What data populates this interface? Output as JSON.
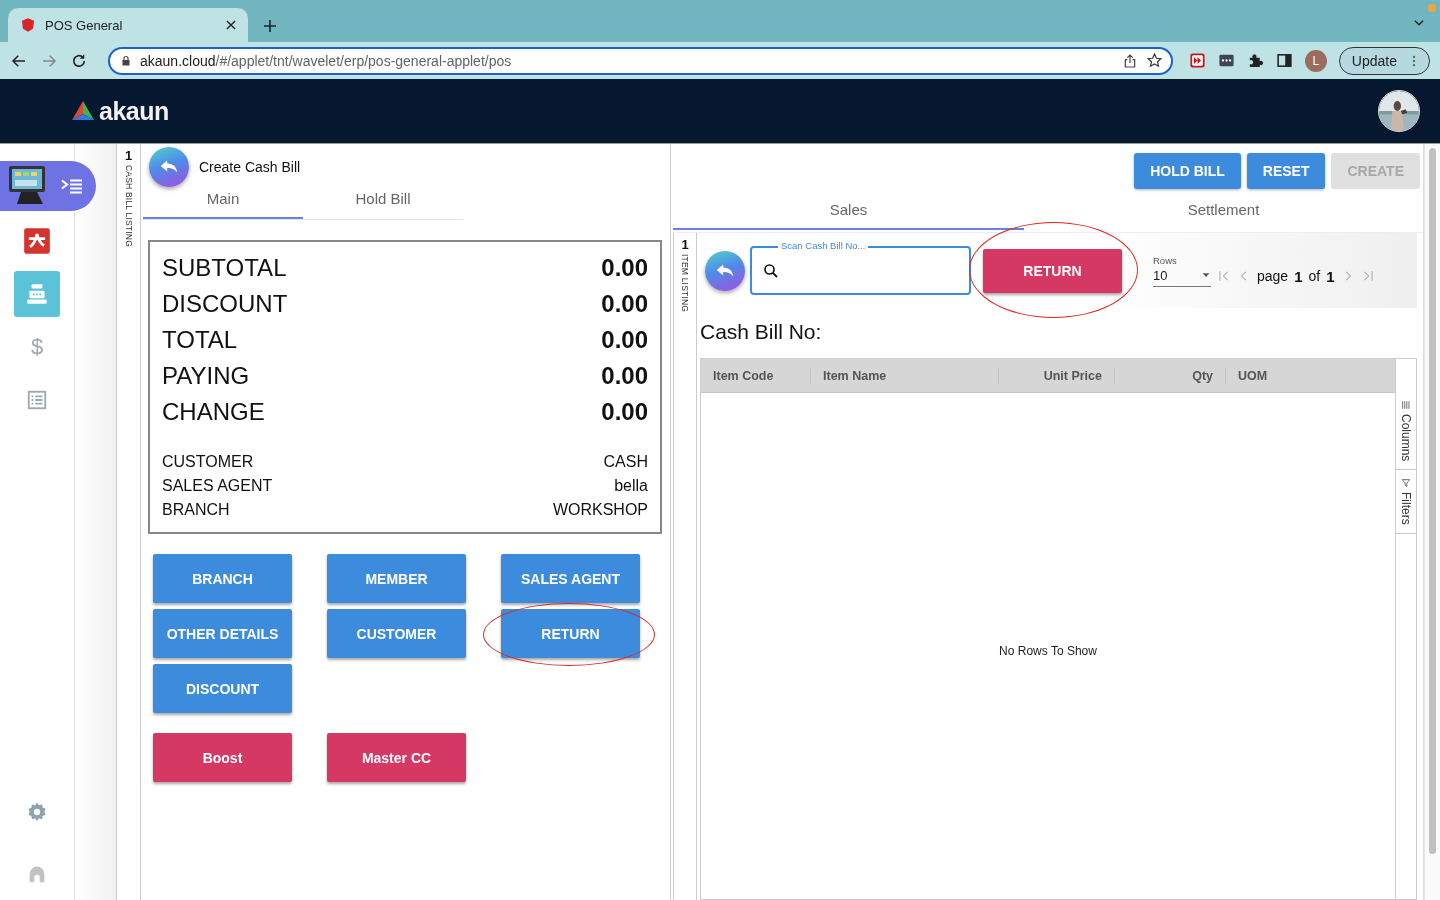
{
  "browser": {
    "tab_title": "POS General",
    "url_host": "akaun.cloud",
    "url_path": "/#/applet/tnt/wavelet/erp/pos-general-applet/pos",
    "profile_initial": "L",
    "update_label": "Update"
  },
  "app": {
    "logo": "akaun"
  },
  "sidebar": {
    "items": [
      {
        "kind": "pos",
        "selected": false
      },
      {
        "kind": "app",
        "selected": false
      },
      {
        "kind": "register",
        "selected": true
      },
      {
        "kind": "glyph",
        "glyph": "$",
        "selected": false
      },
      {
        "kind": "list",
        "selected": false
      }
    ],
    "bottom": [
      {
        "kind": "settings"
      },
      {
        "kind": "user"
      }
    ]
  },
  "bill_panel": {
    "strip_count": "1",
    "strip_label": "CASH BILL LISTING",
    "title": "Create Cash Bill",
    "tabs": [
      {
        "label": "Main",
        "selected": true
      },
      {
        "label": "Hold Bill",
        "selected": false
      }
    ],
    "totals": [
      {
        "label": "SUBTOTAL",
        "value": "0.00"
      },
      {
        "label": "DISCOUNT",
        "value": "0.00"
      },
      {
        "label": "TOTAL",
        "value": "0.00"
      },
      {
        "label": "PAYING",
        "value": "0.00"
      },
      {
        "label": "CHANGE",
        "value": "0.00"
      }
    ],
    "details": [
      {
        "label": "CUSTOMER",
        "value": "CASH"
      },
      {
        "label": "SALES AGENT",
        "value": "bella"
      },
      {
        "label": "BRANCH",
        "value": "WORKSHOP"
      }
    ],
    "buttons": [
      {
        "label": "BRANCH",
        "color": "#3d8bdc",
        "circled": false
      },
      {
        "label": "MEMBER",
        "color": "#3d8bdc",
        "circled": false
      },
      {
        "label": "SALES AGENT",
        "color": "#3d8bdc",
        "circled": false
      },
      {
        "label": "OTHER DETAILS",
        "color": "#3d8bdc",
        "circled": false
      },
      {
        "label": "CUSTOMER",
        "color": "#3d8bdc",
        "circled": false
      },
      {
        "label": "RETURN",
        "color": "#3d8bdc",
        "circled": true
      },
      {
        "label": "DISCOUNT",
        "color": "#3d8bdc",
        "circled": false
      }
    ],
    "payment_buttons": [
      {
        "label": "Boost",
        "color": "#d63864"
      },
      {
        "label": "Master CC",
        "color": "#d63864"
      }
    ]
  },
  "sales_panel": {
    "actions": [
      {
        "label": "HOLD BILL",
        "disabled": false
      },
      {
        "label": "RESET",
        "disabled": false
      },
      {
        "label": "CREATE",
        "disabled": true
      }
    ],
    "tabs": [
      {
        "label": "Sales",
        "selected": true
      },
      {
        "label": "Settlement",
        "selected": false
      }
    ],
    "strip_count": "1",
    "strip_label": "ITEM LISTING",
    "search": {
      "label": "Scan Cash Bill No..."
    },
    "return_button": {
      "label": "RETURN",
      "circled": true
    },
    "pager": {
      "rows_label": "Rows",
      "rows_value": "10",
      "page_word": "page",
      "page": "1",
      "of_word": "of",
      "total": "1"
    },
    "heading": "Cash Bill No:",
    "columns": [
      "Item Code",
      "Item Name",
      "Unit Price",
      "Qty",
      "UOM"
    ],
    "empty_message": "No Rows To Show",
    "side_tools": [
      {
        "kind": "columns",
        "label": "Columns"
      },
      {
        "kind": "filters",
        "label": "Filters"
      }
    ]
  }
}
